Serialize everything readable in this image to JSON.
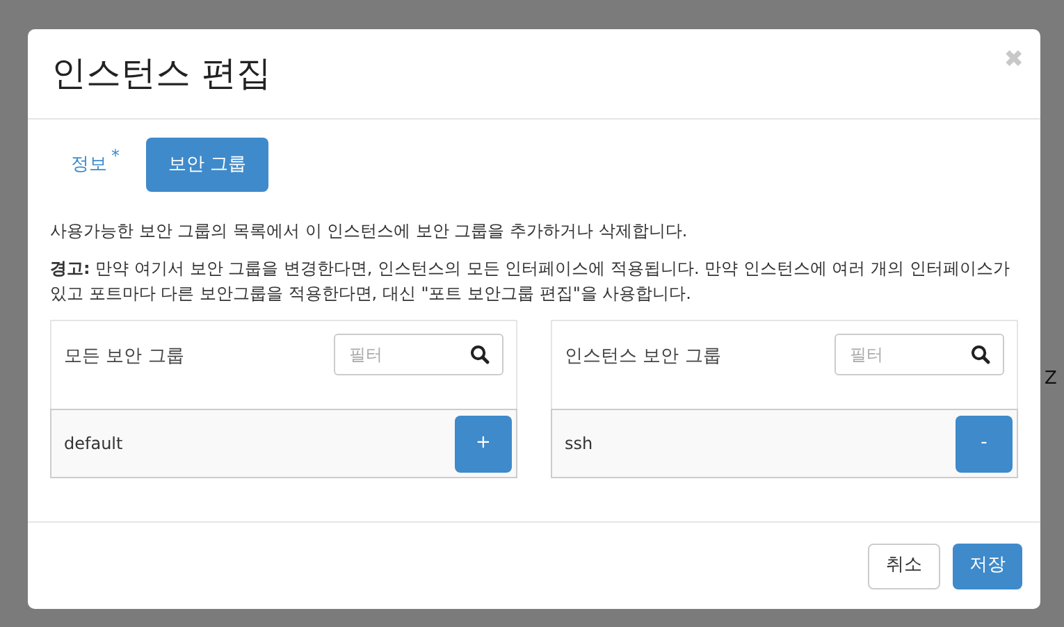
{
  "modal": {
    "title": "인스턴스 편집",
    "close": "✖"
  },
  "tabs": [
    {
      "label": "정보",
      "required": "*",
      "selected": false
    },
    {
      "label": "보안 그룹",
      "selected": true
    }
  ],
  "description": "사용가능한 보안 그룹의 목록에서 이 인스턴스에 보안 그룹을 추가하거나 삭제합니다.",
  "warning": "**경고:** 만약 여기서 보안 그룹을 변경한다면, 인스턴스의 모든 인터페이스에 적용됩니다. 만약 인스턴스에 여러 개의 인터페이스가 있고 포트마다 다른 보안그룹을 적용한다면, 대신 \"포트 보안그룹 편집\"을 사용합니다.",
  "panels": [
    {
      "title": "모든 보안 그룹",
      "filter": {
        "placeholder": "필터"
      },
      "items": [
        {
          "name": "default",
          "action": "+"
        }
      ]
    },
    {
      "title": "인스턴스 보안 그룹",
      "filter": {
        "placeholder": "필터"
      },
      "items": [
        {
          "name": "ssh",
          "action": "-"
        }
      ]
    }
  ],
  "buttons": [
    {
      "label": "취소",
      "kind": "default"
    },
    {
      "label": "저장",
      "kind": "primary"
    }
  ],
  "background": {
    "column_header": "Z"
  }
}
